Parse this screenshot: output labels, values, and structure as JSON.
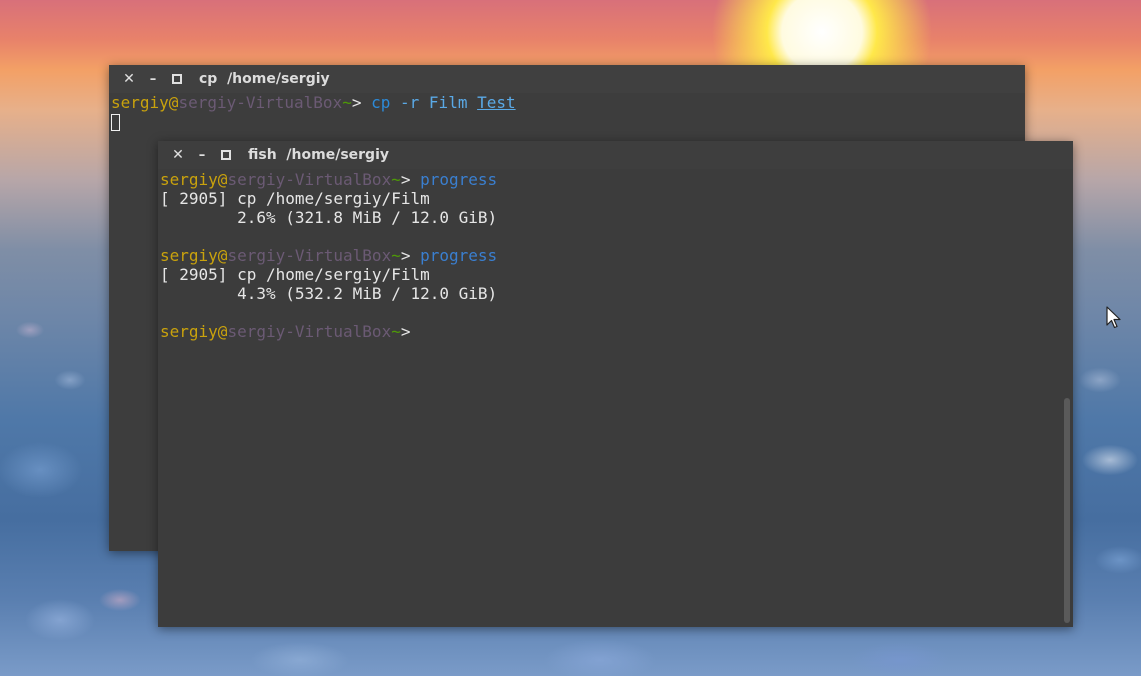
{
  "back_window": {
    "title": "cp  /home/sergiy",
    "buttons": {
      "close": "✕",
      "minimize": "–"
    },
    "prompt": {
      "user": "sergiy",
      "at": "@",
      "host": "sergiy-VirtualBox",
      "tilde": "~",
      "arrow": "> "
    },
    "command": {
      "name": "cp",
      "flag": "-r",
      "arg1": "Film",
      "arg2": "Test"
    }
  },
  "front_window": {
    "title": "fish  /home/sergiy",
    "buttons": {
      "close": "✕",
      "minimize": "–"
    },
    "prompt": {
      "user": "sergiy",
      "at": "@",
      "host": "sergiy-VirtualBox",
      "tilde": "~",
      "arrow": "> "
    },
    "blocks": [
      {
        "command": "progress",
        "output_line1": "[ 2905] cp /home/sergiy/Film",
        "output_line2": "        2.6% (321.8 MiB / 12.0 GiB)"
      },
      {
        "command": "progress",
        "output_line1": "[ 2905] cp /home/sergiy/Film",
        "output_line2": "        4.3% (532.2 MiB / 12.0 GiB)"
      }
    ]
  },
  "colors": {
    "terminal_bg": "#3c3c3c",
    "user": "#c9a20d",
    "host": "#6b5a74",
    "command": "#3a7fd0",
    "tilde": "#4e9a06"
  },
  "icons": [
    "close-icon",
    "minimize-icon",
    "maximize-icon",
    "mouse-pointer-icon"
  ]
}
